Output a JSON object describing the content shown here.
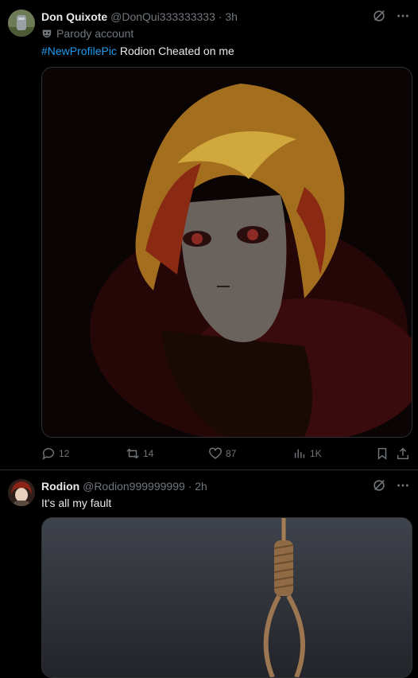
{
  "tweets": [
    {
      "display_name": "Don Quixote",
      "handle": "@DonQui333333333",
      "separator": "·",
      "time": "3h",
      "badge_label": "Parody account",
      "hashtag": "#NewProfilePic",
      "text": "Rodion Cheated on me",
      "stats": {
        "replies": "12",
        "reposts": "14",
        "likes": "87",
        "views": "1K"
      },
      "icons": [
        "grok-icon",
        "more-icon",
        "reply-icon",
        "repost-icon",
        "like-icon",
        "views-icon",
        "bookmark-icon",
        "share-icon"
      ]
    },
    {
      "display_name": "Rodion",
      "handle": "@Rodion999999999",
      "separator": "·",
      "time": "2h",
      "text": "It's all my fault",
      "icons": [
        "grok-icon",
        "more-icon"
      ]
    }
  ],
  "colors": {
    "background": "#000000",
    "text": "#e7e9ea",
    "muted": "#71767b",
    "link": "#1d9bf0",
    "border": "#2f3336"
  }
}
